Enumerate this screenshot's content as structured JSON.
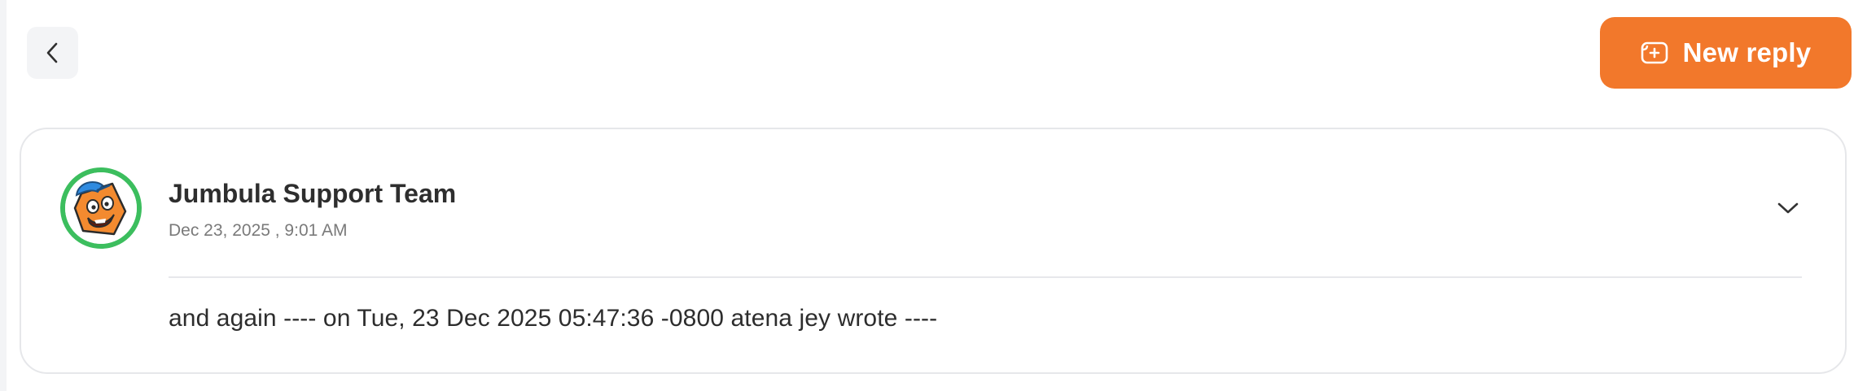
{
  "toolbar": {
    "back_icon": "chevron-left-icon",
    "new_reply_label": "New reply",
    "new_reply_icon": "reply-plus-icon",
    "accent_color": "#F2782B"
  },
  "message": {
    "author": "Jumbula Support Team",
    "timestamp": "Dec 23, 2025 , 9:01 AM",
    "body": "and again ---- on Tue, 23 Dec 2025 05:47:36 -0800 atena jey wrote ----",
    "avatar_ring_color": "#3CBE5E",
    "expand_icon": "chevron-down-icon"
  }
}
